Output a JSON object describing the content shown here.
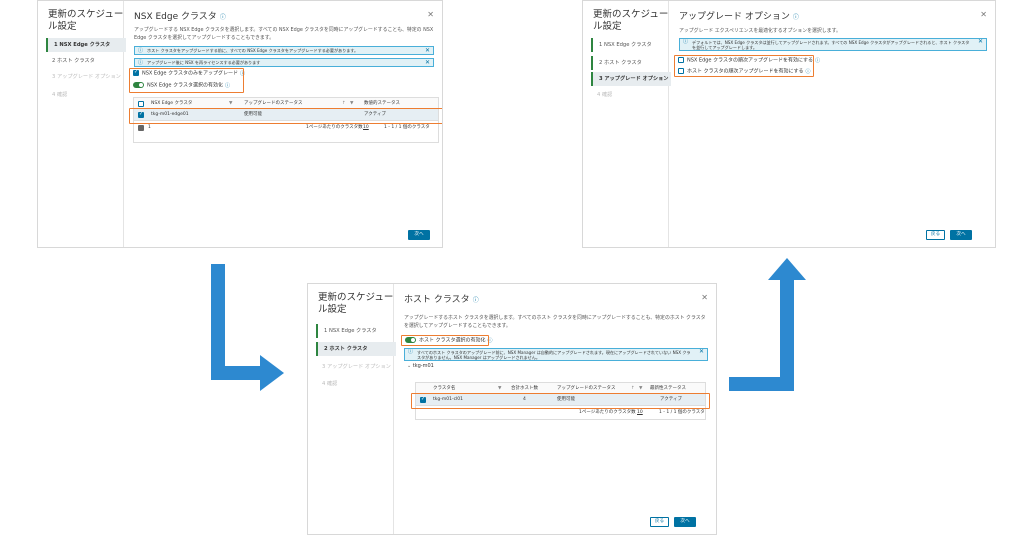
{
  "panel1": {
    "side_title": "更新のスケジュール設定",
    "steps": [
      "1 NSX Edge クラスタ",
      "2 ホスト クラスタ",
      "3 アップグレード オプション",
      "4 確認"
    ],
    "title": "NSX Edge クラスタ",
    "description": "アップグレードする NSX Edge クラスタを選択します。すべての NSX Edge クラスタを同時にアップグレードすることも、特定の NSX Edge クラスタを選択してアップグレードすることもできます。",
    "banners": [
      "ホスト クラスタをアップグレードする前に、すべての NSX Edge クラスタをアップグレードする必要があります。",
      "アップグレード後に NSX を再ライセンスする必要があります"
    ],
    "option_edge_only": "NSX Edge クラスタのみをアップグレード",
    "option_toggle": "NSX Edge クラスタ選択の有効化",
    "columns": [
      "NSX Edge クラスタ",
      "アップグレードのステータス",
      "",
      "",
      "数値的ステータス"
    ],
    "row": {
      "name": "tkg-m01-edge01",
      "status": "使用可能",
      "health": "アクティブ"
    },
    "footer_count": "1",
    "per_page_label": "1ページあたりのクラスタ数",
    "per_page": "10",
    "range": "1 - 1 / 1 個のクラスタ",
    "next_button": "次へ"
  },
  "panel2": {
    "side_title": "更新のスケジュール設定",
    "steps": [
      "1 NSX Edge クラスタ",
      "2 ホスト クラスタ",
      "3 アップグレード オプション",
      "4 確認"
    ],
    "title": "アップグレード オプション",
    "description": "アップグレード エクスペリエンスを最適化するオプションを選択します。",
    "banner": "デフォルトでは、NSX Edge クラスタは並行してアップグレードされます。すべての NSX Edge クラスタがアップグレードされると、ホスト クラスタを並行してアップグレードします。",
    "option_edge_parallel": "NSX Edge クラスタの順次アップグレードを有効にする",
    "option_host_parallel": "ホスト クラスタの順次アップグレードを有効にする",
    "back_button": "戻る",
    "next_button": "次へ"
  },
  "panel3": {
    "side_title": "更新のスケジュール設定",
    "steps": [
      "1 NSX Edge クラスタ",
      "2 ホスト クラスタ",
      "3 アップグレード オプション",
      "4 確認"
    ],
    "title": "ホスト クラスタ",
    "description": "アップグレードするホスト クラスタを選択します。すべてのホスト クラスタを同時にアップグレードすることも、特定のホスト クラスタを選択してアップグレードすることもできます。",
    "option_toggle": "ホスト クラスタ選択の有効化",
    "banner": "すべてのホスト クラスタのアップグレード前に、NSX Manager は自動的にアップグレードされます。現在にアップグレードされていない NSX クラスタがありません。NSX Manager はアップグレードされません。",
    "tree_item": "tkg-m01",
    "columns": [
      "クラスタ名",
      "合計ホスト数",
      "アップグレードのステータス",
      "",
      "",
      "最新性ステータス"
    ],
    "row": {
      "name": "tkg-m01-cl01",
      "hosts": "4",
      "status": "使用可能",
      "health": "アクティブ"
    },
    "per_page_label": "1ページあたりのクラスタ数",
    "per_page": "10",
    "range": "1 - 1 / 1 個のクラスタ",
    "back_button": "戻る",
    "next_button": "次へ"
  },
  "colors": {
    "accent": "#0072a3",
    "highlight": "#ed7d31",
    "arrow": "#2d89d0",
    "toggle": "#2e8540"
  }
}
